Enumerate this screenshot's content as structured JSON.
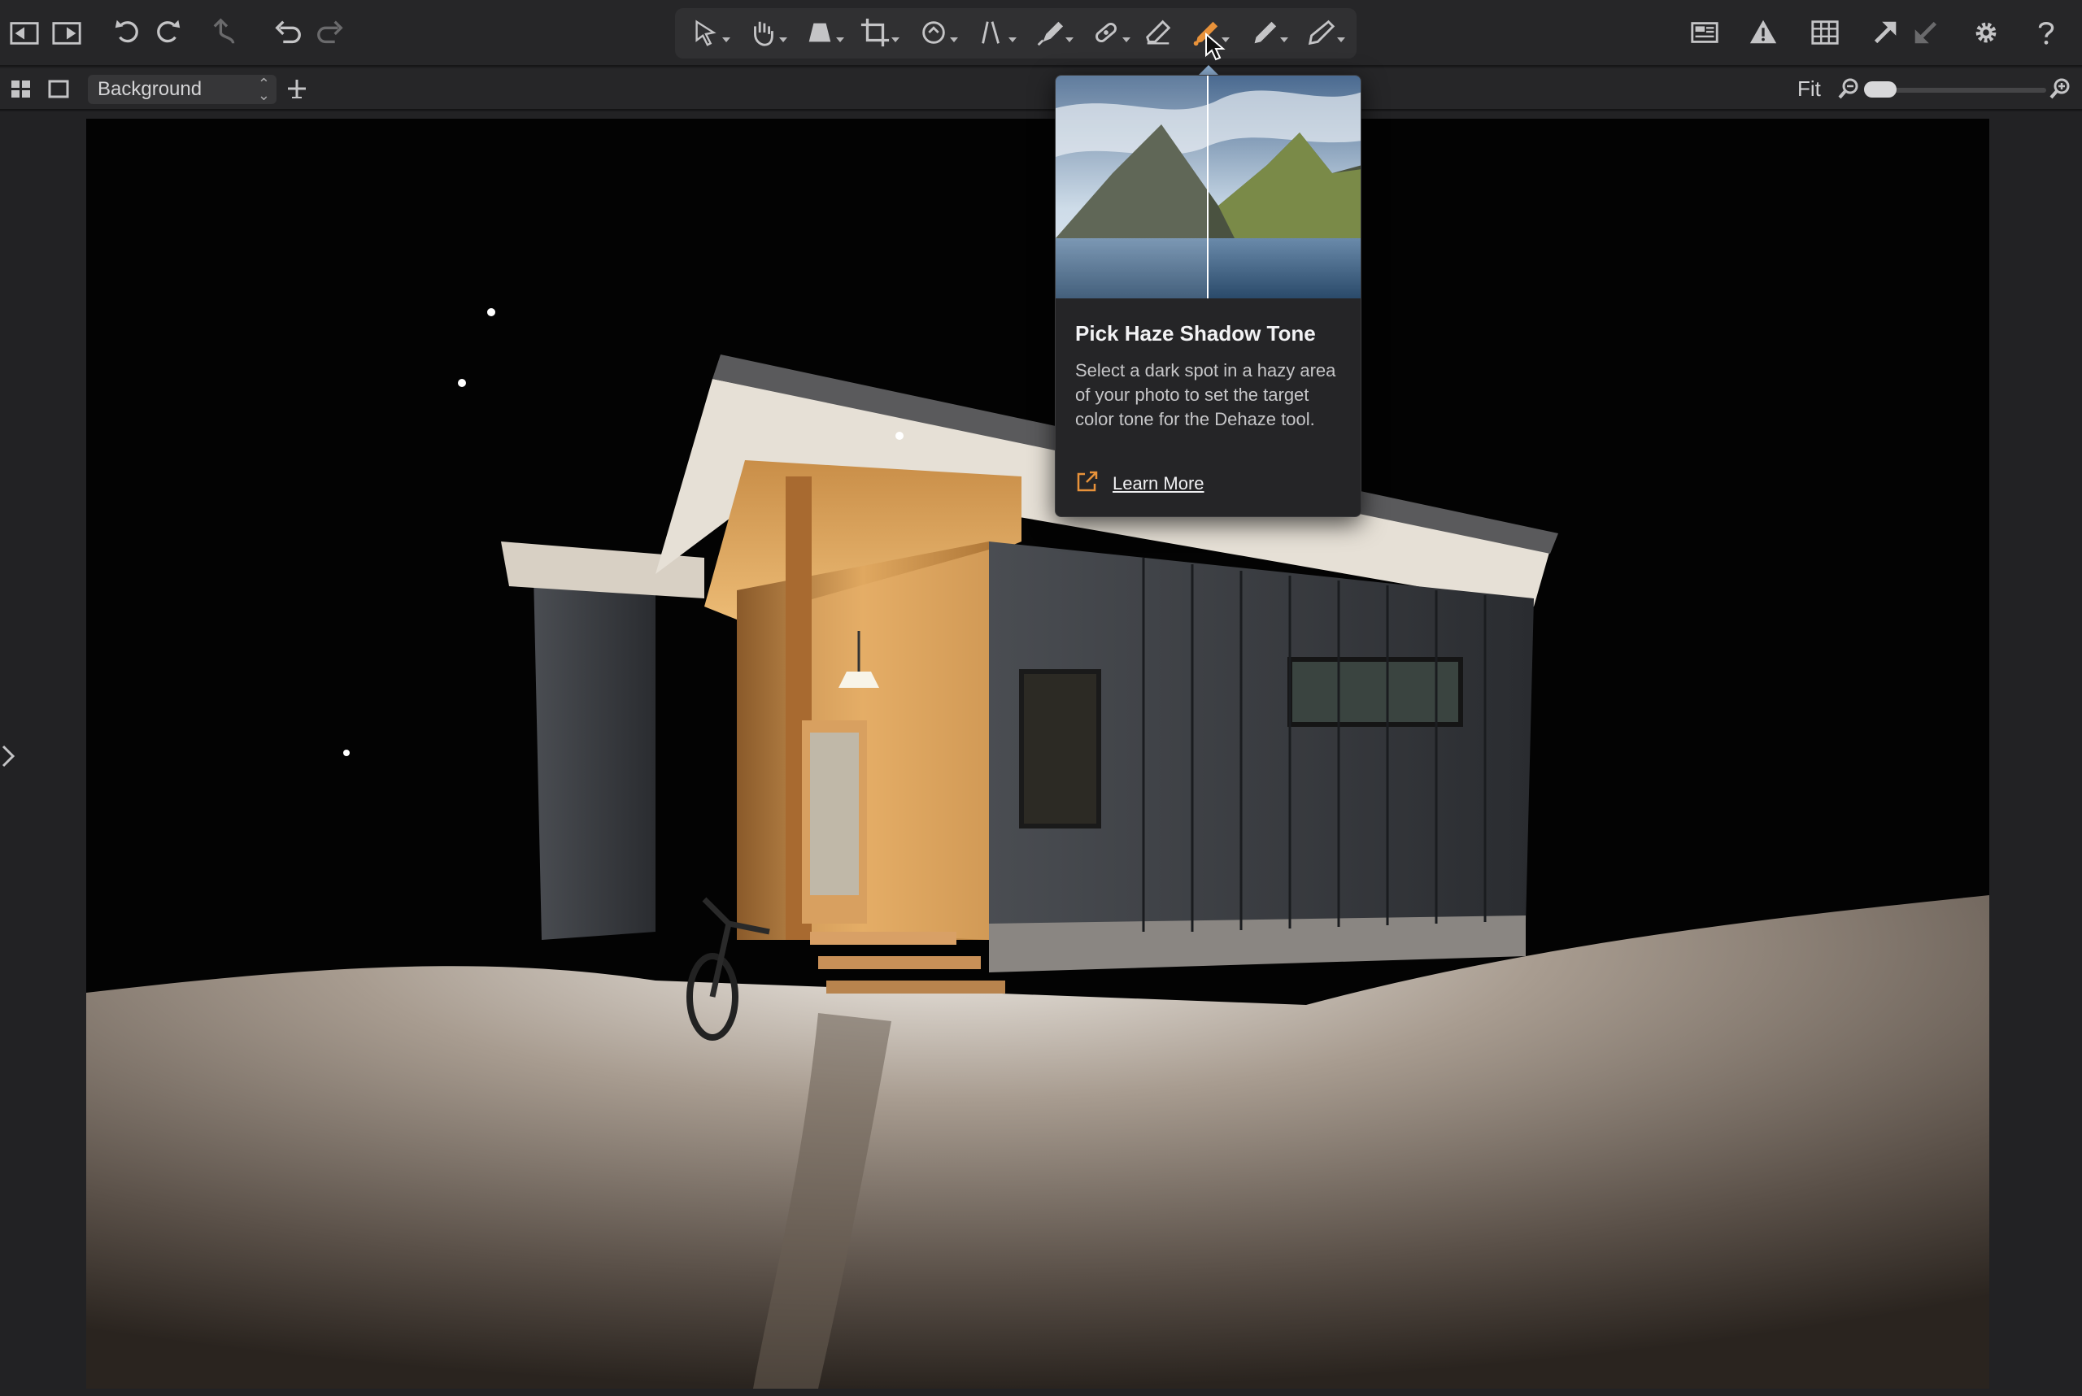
{
  "toolbar": {
    "left_icons": [
      "import-icon",
      "export-icon",
      "rotate-left-icon",
      "rotate-right-icon",
      "undo-step-icon",
      "undo-icon",
      "redo-icon"
    ],
    "tools": [
      "cursor-tool-icon",
      "pan-tool-icon",
      "keystone-tool-icon",
      "crop-tool-icon",
      "rotate-tool-icon",
      "straighten-tool-icon",
      "brush-tool-icon",
      "heal-tool-icon",
      "eraser-tool-icon",
      "haze-picker-icon",
      "color-picker-icon",
      "annotate-tool-icon"
    ],
    "active_tool": "haze-picker-icon",
    "active_color": "#e8923a",
    "right_icons": [
      "layout-icon",
      "warning-icon",
      "grid-icon",
      "move-up-icon",
      "move-down-icon",
      "settings-gear-icon",
      "help-icon"
    ]
  },
  "subbar": {
    "layer_name": "Background",
    "fit_label": "Fit",
    "zoom_fraction": 0.12
  },
  "tooltip": {
    "title": "Pick Haze Shadow Tone",
    "description": "Select a dark spot in a hazy area of your photo to set the target color tone for the Dehaze tool.",
    "link_label": "Learn More",
    "link_icon": "external-link-icon",
    "link_icon_color": "#e8923a"
  }
}
